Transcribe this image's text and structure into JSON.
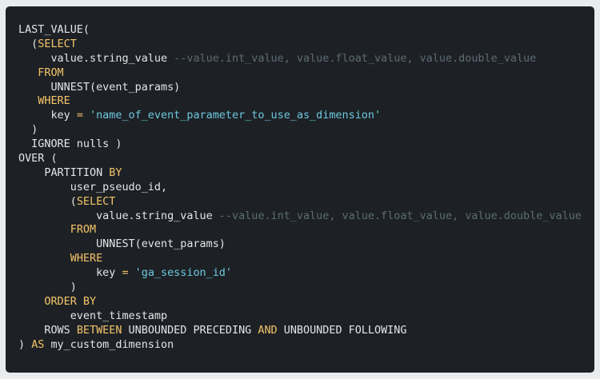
{
  "code": {
    "lines": [
      [
        {
          "t": "pl",
          "v": "LAST_VALUE("
        }
      ],
      [
        {
          "t": "pl",
          "v": "  ("
        },
        {
          "t": "kw",
          "v": "SELECT"
        }
      ],
      [
        {
          "t": "pl",
          "v": "     value.string_value "
        },
        {
          "t": "cm",
          "v": "--value.int_value, value.float_value, value.double_value"
        }
      ],
      [
        {
          "t": "pl",
          "v": "   "
        },
        {
          "t": "kw",
          "v": "FROM"
        }
      ],
      [
        {
          "t": "pl",
          "v": "     UNNEST(event_params)"
        }
      ],
      [
        {
          "t": "pl",
          "v": "   "
        },
        {
          "t": "kw",
          "v": "WHERE"
        }
      ],
      [
        {
          "t": "pl",
          "v": "     key "
        },
        {
          "t": "kw",
          "v": "="
        },
        {
          "t": "pl",
          "v": " "
        },
        {
          "t": "str",
          "v": "'name_of_event_parameter_to_use_as_dimension'"
        }
      ],
      [
        {
          "t": "pl",
          "v": "  )"
        }
      ],
      [
        {
          "t": "pl",
          "v": "  IGNORE nulls )"
        }
      ],
      [
        {
          "t": "pl",
          "v": "OVER ("
        }
      ],
      [
        {
          "t": "pl",
          "v": "    PARTITION "
        },
        {
          "t": "kw",
          "v": "BY"
        }
      ],
      [
        {
          "t": "pl",
          "v": "        user_pseudo_id,"
        }
      ],
      [
        {
          "t": "pl",
          "v": "        ("
        },
        {
          "t": "kw",
          "v": "SELECT"
        }
      ],
      [
        {
          "t": "pl",
          "v": "            value.string_value "
        },
        {
          "t": "cm",
          "v": "--value.int_value, value.float_value, value.double_value"
        }
      ],
      [
        {
          "t": "pl",
          "v": "        "
        },
        {
          "t": "kw",
          "v": "FROM"
        }
      ],
      [
        {
          "t": "pl",
          "v": "            UNNEST(event_params)"
        }
      ],
      [
        {
          "t": "pl",
          "v": "        "
        },
        {
          "t": "kw",
          "v": "WHERE"
        }
      ],
      [
        {
          "t": "pl",
          "v": "            key "
        },
        {
          "t": "kw",
          "v": "="
        },
        {
          "t": "pl",
          "v": " "
        },
        {
          "t": "str",
          "v": "'ga_session_id'"
        }
      ],
      [
        {
          "t": "pl",
          "v": "        )"
        }
      ],
      [
        {
          "t": "pl",
          "v": "    "
        },
        {
          "t": "kw",
          "v": "ORDER BY"
        }
      ],
      [
        {
          "t": "pl",
          "v": "        event_timestamp"
        }
      ],
      [
        {
          "t": "pl",
          "v": "    ROWS "
        },
        {
          "t": "kw",
          "v": "BETWEEN"
        },
        {
          "t": "pl",
          "v": " UNBOUNDED PRECEDING "
        },
        {
          "t": "kw",
          "v": "AND"
        },
        {
          "t": "pl",
          "v": " UNBOUNDED FOLLOWING"
        }
      ],
      [
        {
          "t": "pl",
          "v": ") "
        },
        {
          "t": "kw",
          "v": "AS"
        },
        {
          "t": "pl",
          "v": " my_custom_dimension"
        }
      ]
    ]
  }
}
